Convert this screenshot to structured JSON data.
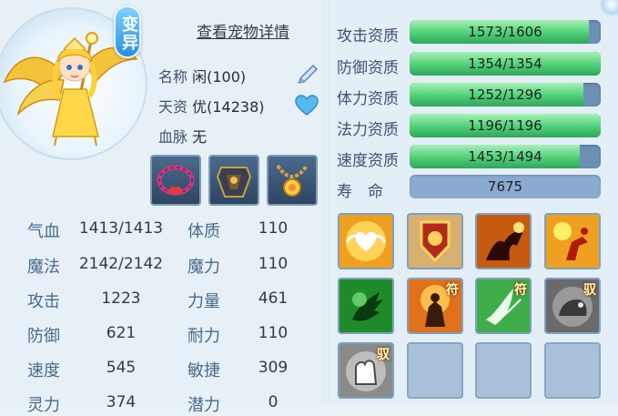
{
  "pet": {
    "variant_badge": "变异",
    "detail_link": "查看宠物详情",
    "name_label": "名称",
    "name_value": "闲(100)",
    "talent_label": "天资",
    "talent_value": "优(14238)",
    "bloodline_label": "血脉",
    "bloodline_value": "无"
  },
  "attributes": {
    "left": [
      {
        "label": "气血",
        "value": "1413/1413"
      },
      {
        "label": "魔法",
        "value": "2142/2142"
      },
      {
        "label": "攻击",
        "value": "1223"
      },
      {
        "label": "防御",
        "value": "621"
      },
      {
        "label": "速度",
        "value": "545"
      },
      {
        "label": "灵力",
        "value": "374"
      }
    ],
    "right": [
      {
        "label": "体质",
        "value": "110"
      },
      {
        "label": "魔力",
        "value": "110"
      },
      {
        "label": "力量",
        "value": "461"
      },
      {
        "label": "耐力",
        "value": "110"
      },
      {
        "label": "敏捷",
        "value": "309"
      },
      {
        "label": "潜力",
        "value": "0"
      }
    ]
  },
  "aptitudes": [
    {
      "label": "攻击资质",
      "value": "1573/1606",
      "fraction": 0.94
    },
    {
      "label": "防御资质",
      "value": "1354/1354",
      "fraction": 1.0
    },
    {
      "label": "体力资质",
      "value": "1252/1296",
      "fraction": 0.91
    },
    {
      "label": "法力资质",
      "value": "1196/1196",
      "fraction": 1.0
    },
    {
      "label": "速度资质",
      "value": "1453/1494",
      "fraction": 0.89
    }
  ],
  "lifespan": {
    "label": "寿　命",
    "value": "7675"
  },
  "skills": [
    {
      "name": "winged-heart-skill-icon",
      "tag": ""
    },
    {
      "name": "golden-shield-skill-icon",
      "tag": ""
    },
    {
      "name": "shadow-strike-skill-icon",
      "tag": ""
    },
    {
      "name": "fire-dash-skill-icon",
      "tag": ""
    },
    {
      "name": "green-claw-skill-icon",
      "tag": ""
    },
    {
      "name": "flame-warrior-skill-icon",
      "tag": "符"
    },
    {
      "name": "white-wing-skill-icon",
      "tag": "符"
    },
    {
      "name": "stone-beast-skill-icon",
      "tag": "驭"
    },
    {
      "name": "fist-skill-icon",
      "tag": "驭"
    },
    {
      "name": "empty-skill-slot",
      "tag": ""
    },
    {
      "name": "empty-skill-slot",
      "tag": ""
    },
    {
      "name": "empty-skill-slot",
      "tag": ""
    }
  ],
  "colors": {
    "bar_fill": "#4fcf78",
    "bar_track": "#6b8fb5",
    "label_text": "#3f5370"
  }
}
